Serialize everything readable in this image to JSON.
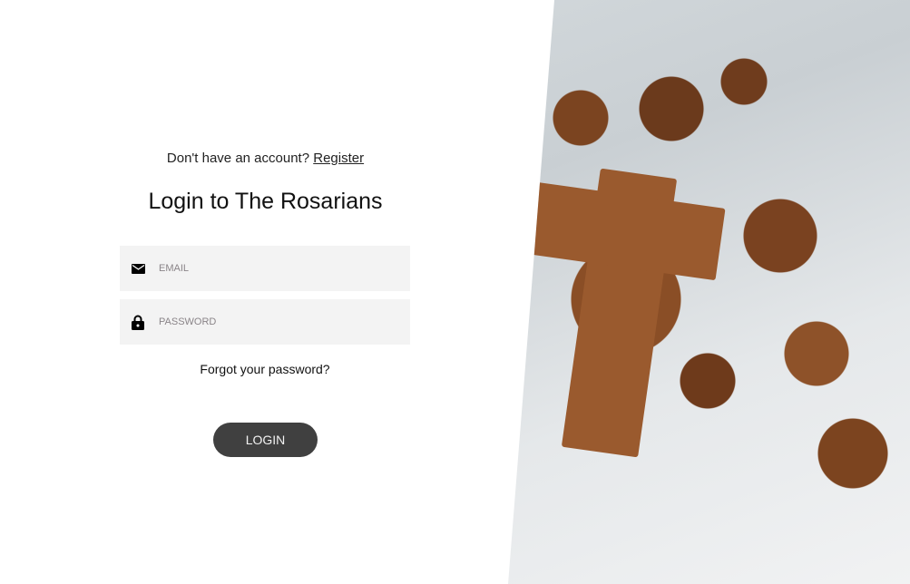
{
  "signup": {
    "prompt": "Don't have an account?",
    "link": "Register"
  },
  "title": "Login to The Rosarians",
  "email": {
    "placeholder": "EMAIL",
    "icon": "mail-icon"
  },
  "password": {
    "placeholder": "PASSWORD",
    "icon": "lock-icon"
  },
  "forgot_label": "Forgot your password?",
  "login_label": "LOGIN"
}
